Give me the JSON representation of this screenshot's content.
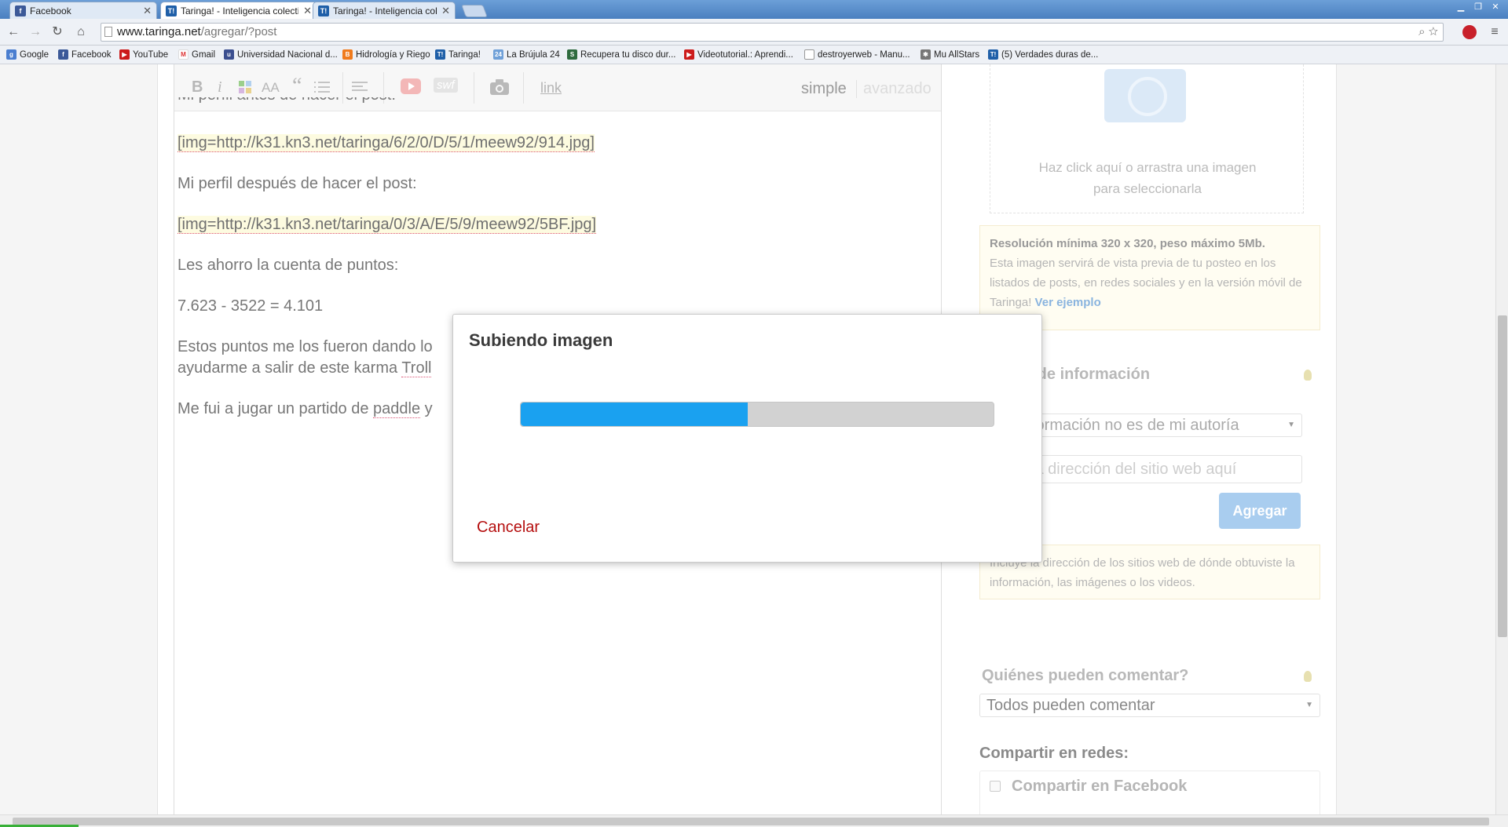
{
  "browser": {
    "tabs": [
      {
        "label": "Facebook",
        "icon": "facebook-icon"
      },
      {
        "label": "Taringa! - Inteligencia colecti",
        "icon": "taringa-icon"
      },
      {
        "label": "Taringa! - Inteligencia colecti",
        "icon": "taringa-icon"
      }
    ],
    "url_host": "www.taringa.net",
    "url_path": "/agregar/?post",
    "bookmarks": [
      {
        "label": "Google",
        "icon": "google-icon"
      },
      {
        "label": "Facebook",
        "icon": "facebook-icon"
      },
      {
        "label": "YouTube",
        "icon": "youtube-icon"
      },
      {
        "label": "Gmail",
        "icon": "gmail-icon"
      },
      {
        "label": "Universidad Nacional d...",
        "icon": "unc-icon"
      },
      {
        "label": "Hidrología y Riego",
        "icon": "blogger-icon"
      },
      {
        "label": "Taringa!",
        "icon": "taringa-icon"
      },
      {
        "label": "La Brújula 24",
        "icon": "brujula-icon"
      },
      {
        "label": "Recupera tu disco dur...",
        "icon": "sz-icon"
      },
      {
        "label": "Videotutorial.: Aprendi...",
        "icon": "youtube-icon"
      },
      {
        "label": "destroyerweb - Manu...",
        "icon": "page-icon"
      },
      {
        "label": "Mu AllStars",
        "icon": "mu-icon"
      },
      {
        "label": "(5) Verdades duras de...",
        "icon": "taringa-icon"
      }
    ]
  },
  "editor": {
    "toolbar": {
      "bold": "B",
      "italic": "i",
      "font_size": "AA",
      "quote": "“",
      "swf": "swf",
      "link": "link",
      "mode_simple": "simple",
      "mode_advanced": "avanzado"
    },
    "lines": {
      "l1": "Mi perfil antes de hacer el post:",
      "l2": "[img=http://k31.kn3.net/taringa/6/2/0/D/5/1/meew92/914.jpg]",
      "l3": "Mi perfil después de hacer el post:",
      "l4": "[img=http://k31.kn3.net/taringa/0/3/A/E/5/9/meew92/5BF.jpg]",
      "l5": "Les ahorro la cuenta de puntos:",
      "l6": "7.623 - 3522 = 4.101",
      "l7": "Estos puntos me los fueron dando lo",
      "l8a": "ayudarme a salir de este karma ",
      "l8b": "Troll",
      "l9a": "Me fui a jugar un partido de ",
      "l9b": "paddle",
      "l9c": " y"
    }
  },
  "sidebar": {
    "image_hint_1": "Haz click aquí o arrastra una imagen",
    "image_hint_2": "para seleccionarla",
    "res_title": "Resolución mínima 320 x 320, peso máximo 5Mb.",
    "res_text": "Esta imagen servirá de vista previa de tu posteo en los listados de posts, en redes sociales y en la versión móvil de Taringa!",
    "res_link": "Ver ejemplo",
    "source_title": "e de información",
    "source_select": "formación no es de mi autoría",
    "source_input_placeholder": "la dirección del sitio web aquí",
    "add_button": "Agregar",
    "source_help": "Incluye la dirección de los sitios web de dónde obtuviste la información, las imágenes o los videos.",
    "comments_title": "Quiénes pueden comentar?",
    "comments_select": "Todos pueden comentar",
    "share_title": "Compartir en redes:",
    "share_facebook": "Compartir en Facebook"
  },
  "dialog": {
    "title": "Subiendo imagen",
    "progress_fraction": 0.48,
    "cancel": "Cancelar",
    "progress_color": "#1aa1f0",
    "cancel_color": "#b50f0f"
  }
}
